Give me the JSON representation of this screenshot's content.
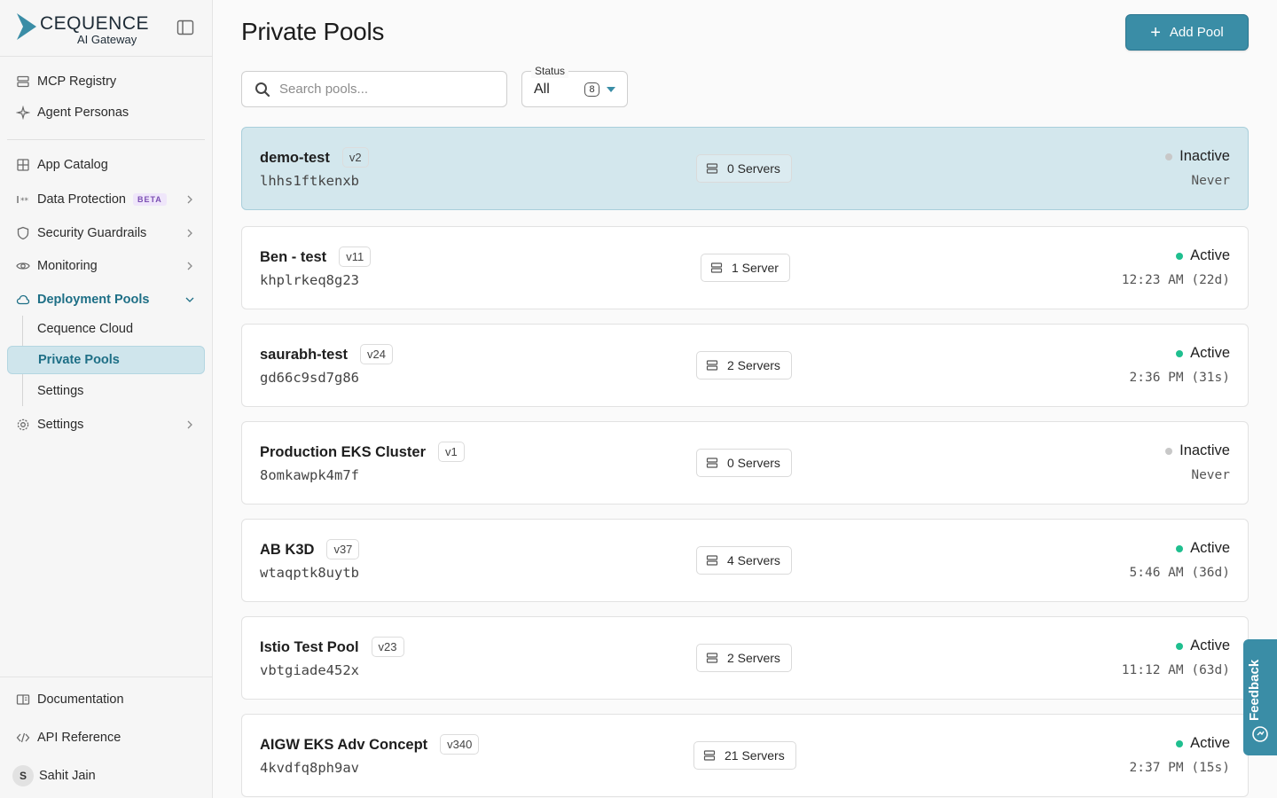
{
  "brand": {
    "name": "CEQUENCE",
    "product": "AI Gateway"
  },
  "sidebar": {
    "items": [
      {
        "label": "MCP Registry",
        "icon": "server-icon"
      },
      {
        "label": "Agent Personas",
        "icon": "sparkle-icon"
      },
      {
        "label": "App Catalog",
        "icon": "grid-icon"
      },
      {
        "label": "Data Protection",
        "icon": "masked-data-icon",
        "badge": "BETA"
      },
      {
        "label": "Security Guardrails",
        "icon": "shield-icon"
      },
      {
        "label": "Monitoring",
        "icon": "eye-icon"
      },
      {
        "label": "Deployment Pools",
        "icon": "cloud-icon"
      },
      {
        "label": "Settings",
        "icon": "gear-icon"
      }
    ],
    "sub_items": [
      {
        "label": "Cequence Cloud"
      },
      {
        "label": "Private Pools",
        "active": true
      },
      {
        "label": "Settings"
      }
    ],
    "bottom": {
      "documentation": "Documentation",
      "api_reference": "API Reference",
      "user_initial": "S",
      "user_name": "Sahit Jain"
    }
  },
  "page": {
    "title": "Private Pools",
    "add_button": "Add Pool"
  },
  "search": {
    "placeholder": "Search pools..."
  },
  "status_filter": {
    "legend": "Status",
    "value": "All",
    "count": "8"
  },
  "pools": [
    {
      "name": "demo-test",
      "version": "v2",
      "id": "lhhs1ftkenxb",
      "servers": "0 Servers",
      "status": "Inactive",
      "last_seen": "Never",
      "selected": true
    },
    {
      "name": "Ben - test",
      "version": "v11",
      "id": "khplrkeq8g23",
      "servers": "1 Server",
      "status": "Active",
      "last_seen": "12:23 AM (22d)"
    },
    {
      "name": "saurabh-test",
      "version": "v24",
      "id": "gd66c9sd7g86",
      "servers": "2 Servers",
      "status": "Active",
      "last_seen": "2:36 PM (31s)"
    },
    {
      "name": "Production EKS Cluster",
      "version": "v1",
      "id": "8omkawpk4m7f",
      "servers": "0 Servers",
      "status": "Inactive",
      "last_seen": "Never"
    },
    {
      "name": "AB K3D",
      "version": "v37",
      "id": "wtaqptk8uytb",
      "servers": "4 Servers",
      "status": "Active",
      "last_seen": "5:46 AM (36d)"
    },
    {
      "name": "Istio Test Pool",
      "version": "v23",
      "id": "vbtgiade452x",
      "servers": "2 Servers",
      "status": "Active",
      "last_seen": "11:12 AM (63d)"
    },
    {
      "name": "AIGW EKS Adv Concept",
      "version": "v340",
      "id": "4kvdfq8ph9av",
      "servers": "21 Servers",
      "status": "Active",
      "last_seen": "2:37 PM (15s)"
    }
  ],
  "colors": {
    "accent": "#3a8da6",
    "active_dot": "#1fbf8f",
    "inactive_dot": "#c8c8c8",
    "selected_bg": "#d3e7ed"
  },
  "feedback": {
    "label": "Feedback"
  }
}
